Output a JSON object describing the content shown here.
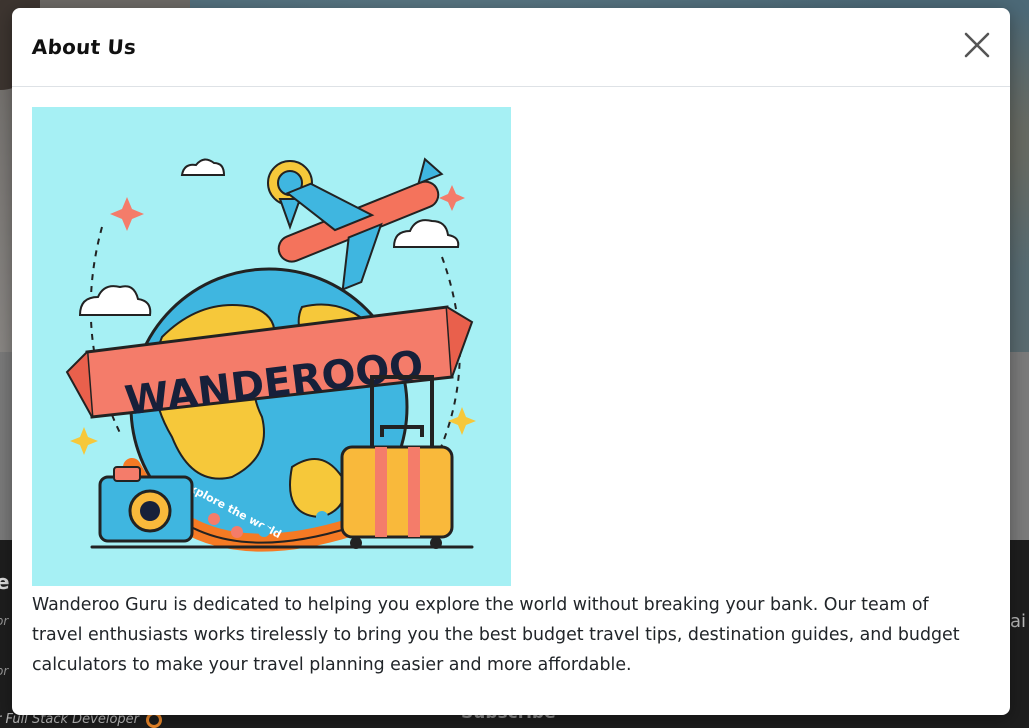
{
  "background": {
    "footer_fragments": {
      "heading_fragment": "e",
      "line_fragment_1": "or",
      "line_fragment_2": "or",
      "credit_fragment": "r Full Stack Developer",
      "right_fragment": "ai",
      "subscribe_fragment": "Subscribe"
    }
  },
  "modal": {
    "title": "About Us",
    "close_icon": "close-icon",
    "image": {
      "banner_text": "WANDEROOO",
      "ribbon_text": "Explore the world",
      "colors": {
        "sky": "#a6f0f4",
        "ribbon": "#f47c6a",
        "globe_sea": "#3fb6e0",
        "globe_land": "#f6c83a",
        "orbit": "#f57a24",
        "plane": "#f4735c",
        "suitcase": "#f9b93b",
        "camera": "#3fb6e0"
      }
    },
    "description": "Wanderoo Guru is dedicated to helping you explore the world without breaking your bank. Our team of travel enthusiasts works tirelessly to bring you the best budget travel tips, destination guides, and budget calculators to make your travel planning easier and more affordable."
  }
}
